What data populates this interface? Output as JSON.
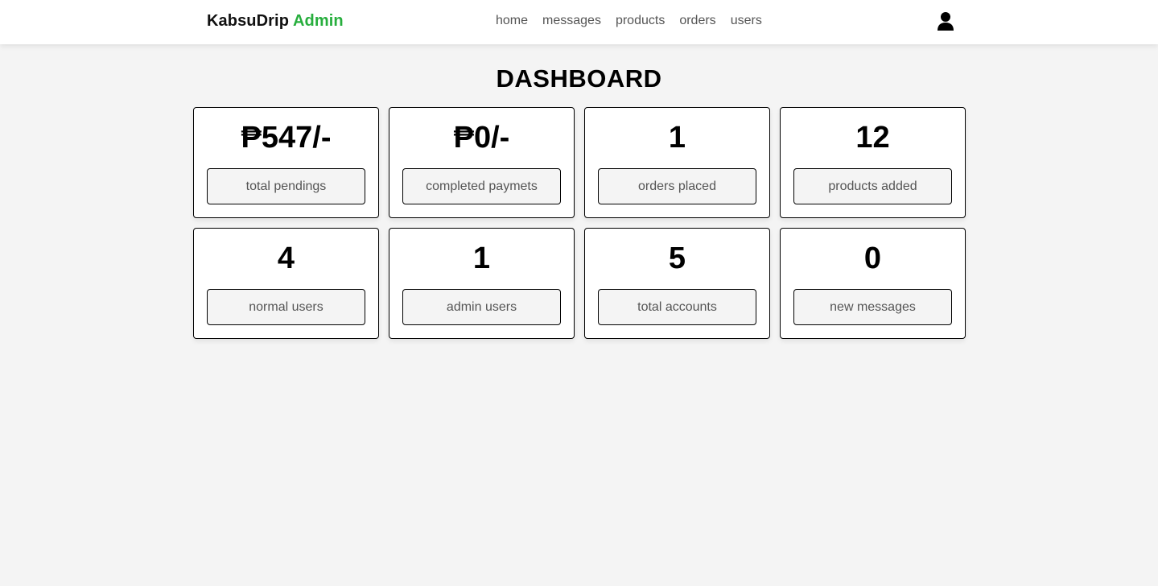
{
  "header": {
    "logo_main": "KabsuDrip",
    "logo_accent": "Admin",
    "accent_color": "#27ae3d",
    "nav": [
      {
        "label": "home"
      },
      {
        "label": "messages"
      },
      {
        "label": "products"
      },
      {
        "label": "orders"
      },
      {
        "label": "users"
      }
    ],
    "user_icon": "user-icon"
  },
  "main": {
    "title": "DASHBOARD",
    "cards": [
      {
        "value": "₱547/-",
        "label": "total pendings"
      },
      {
        "value": "₱0/-",
        "label": "completed paymets"
      },
      {
        "value": "1",
        "label": "orders placed"
      },
      {
        "value": "12",
        "label": "products added"
      },
      {
        "value": "4",
        "label": "normal users"
      },
      {
        "value": "1",
        "label": "admin users"
      },
      {
        "value": "5",
        "label": "total accounts"
      },
      {
        "value": "0",
        "label": "new messages"
      }
    ]
  }
}
